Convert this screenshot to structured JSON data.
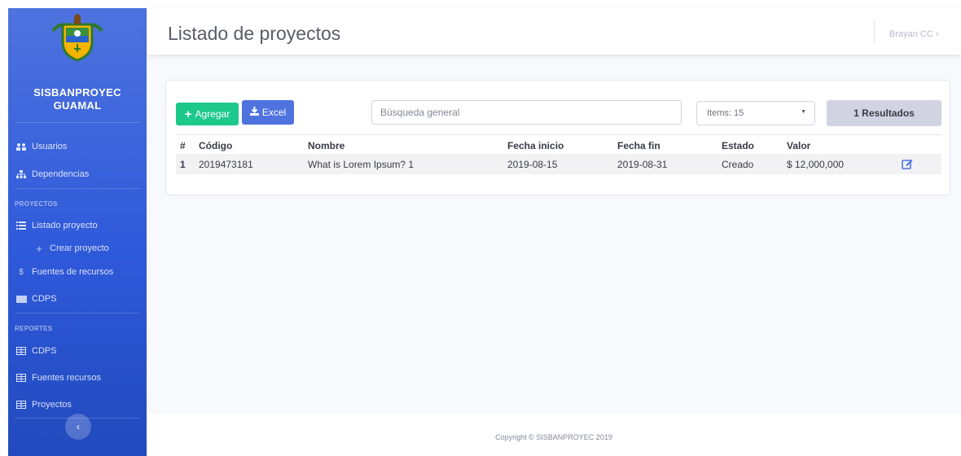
{
  "app": {
    "name_line1": "SISBANPROYEC",
    "name_line2": "GUAMAL",
    "logo_icon": "coat-of-arms-icon"
  },
  "sidebar": {
    "items": [
      {
        "label": "Usuarios",
        "icon": "users-icon"
      },
      {
        "label": "Dependencias",
        "icon": "sitemap-icon"
      }
    ],
    "proyectos_heading": "PROYECTOS",
    "proyectos_items": [
      {
        "label": "Listado proyecto",
        "icon": "list-icon"
      },
      {
        "label": "Crear proyecto",
        "icon": "plus-icon"
      },
      {
        "label": "Fuentes de recursos",
        "icon": "dollar-icon"
      },
      {
        "label": "CDPS",
        "icon": "card-icon"
      }
    ],
    "reportes_heading": "REPORTES",
    "reportes_items": [
      {
        "label": "CDPS",
        "icon": "table-icon"
      },
      {
        "label": "Fuentes recursos",
        "icon": "table-icon"
      },
      {
        "label": "Proyectos",
        "icon": "table-icon"
      }
    ],
    "toggle_icon": "chevron-left-icon",
    "toggle_symbol": "‹"
  },
  "header": {
    "title": "Listado de proyectos",
    "user": "Brayan CC ›"
  },
  "toolbar": {
    "add_label": "Agregar",
    "add_symbol": "+",
    "excel_label": "Excel",
    "excel_symbol": "⭳",
    "search_placeholder": "Búsqueda general",
    "items_select": "Items: 15",
    "items_caret": "▼",
    "results_label": "1 Resultados"
  },
  "table": {
    "headers": [
      "#",
      "Código",
      "Nombre",
      "Fecha inicio",
      "Fecha fin",
      "Estado",
      "Valor"
    ],
    "rows": [
      {
        "num": "1",
        "codigo": "2019473181",
        "nombre": "What is Lorem Ipsum? 1",
        "fecha_inicio": "2019-08-15",
        "fecha_fin": "2019-08-31",
        "estado": "Creado",
        "valor": "$ 12,000,000",
        "action_icon": "edit-icon"
      }
    ]
  },
  "footer": {
    "copyright": "Copyright © SISBANPROYEC 2019"
  },
  "colors": {
    "sidebar": "#4e73df",
    "success": "#1cc88a",
    "primary": "#4e73df",
    "results_bg": "#d1d3e2"
  }
}
